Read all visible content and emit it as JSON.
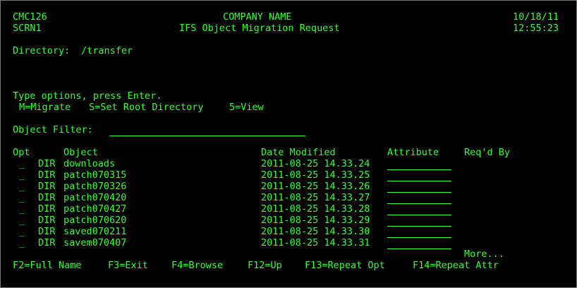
{
  "colors": {
    "background": "#000000",
    "text": "#33ff33",
    "border": "#7a7a7a"
  },
  "header": {
    "program_id": "CMC126",
    "screen_id": "SCRN1",
    "company": "COMPANY NAME",
    "title": "IFS Object Migration Request",
    "date": "10/18/11",
    "time": "12:55:23"
  },
  "directory": {
    "label": "Directory:",
    "value": "/transfer"
  },
  "instructions": {
    "line1": "Type options, press Enter.",
    "options": {
      "migrate": "M=Migrate",
      "set_root": "S=Set Root Directory",
      "view": "5=View"
    }
  },
  "filter": {
    "label": "Object Filter:",
    "value": ""
  },
  "columns": {
    "opt": "Opt",
    "object": "Object",
    "date_modified": "Date Modified",
    "attribute": "Attribute",
    "reqd_by": "Req'd By"
  },
  "rows": [
    {
      "opt": "_",
      "type": "DIR",
      "name": "downloads",
      "modified": "2011-08-25 14.33.24"
    },
    {
      "opt": "_",
      "type": "DIR",
      "name": "patch070315",
      "modified": "2011-08-25 14.33.25"
    },
    {
      "opt": "_",
      "type": "DIR",
      "name": "patch070326",
      "modified": "2011-08-25 14.33.26"
    },
    {
      "opt": "_",
      "type": "DIR",
      "name": "patch070420",
      "modified": "2011-08-25 14.33.27"
    },
    {
      "opt": "_",
      "type": "DIR",
      "name": "patch070427",
      "modified": "2011-08-25 14.33.28"
    },
    {
      "opt": "_",
      "type": "DIR",
      "name": "patch070620",
      "modified": "2011-08-25 14.33.29"
    },
    {
      "opt": "_",
      "type": "DIR",
      "name": "saved070211",
      "modified": "2011-08-25 14.33.30"
    },
    {
      "opt": "_",
      "type": "DIR",
      "name": "savem070407",
      "modified": "2011-08-25 14.33.31"
    }
  ],
  "more": "More...",
  "function_keys": {
    "f2": "F2=Full Name",
    "f3": "F3=Exit",
    "f4": "F4=Browse",
    "f12": "F12=Up",
    "f13": "F13=Repeat Opt",
    "f14": "F14=Repeat Attr"
  }
}
